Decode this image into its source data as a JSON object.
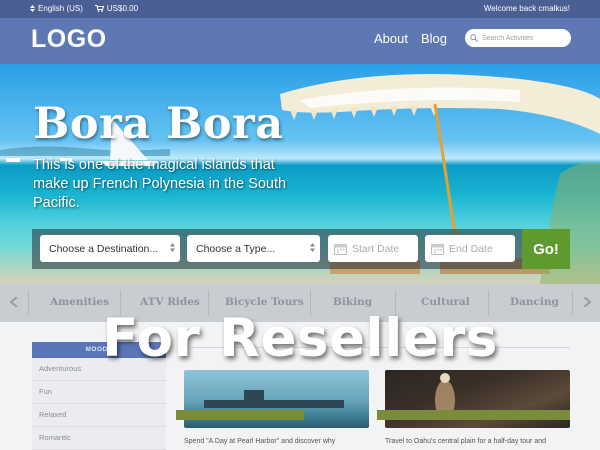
{
  "topbar": {
    "language": "English (US)",
    "currency": "US$0.00",
    "welcome": "Welcome back cmalkus!"
  },
  "header": {
    "logo": "LOGO",
    "nav": [
      "About",
      "Blog"
    ],
    "search_placeholder": "Search Activities"
  },
  "hero": {
    "title": "Bora Bora",
    "description": "This is one of the magical islands that make up French Polynesia in the South Pacific."
  },
  "booking": {
    "destination": "Choose a Destination...",
    "type": "Choose a Type...",
    "start_date": "Start Date",
    "end_date": "End Date",
    "go": "Go!"
  },
  "categories": [
    "Amenities",
    "ATV Rides",
    "Bicycle Tours",
    "Biking",
    "Cultural",
    "Dancing"
  ],
  "sidebar": {
    "heading": "MOODS",
    "items": [
      "Adventurous",
      "Fun",
      "Relaxed",
      "Romantic"
    ]
  },
  "cards": [
    {
      "snippet": "Spend \"A Day at Pearl Harbor\" and discover why"
    },
    {
      "snippet": "Travel to Oahu's central plain for a half-day tour and"
    }
  ],
  "overlay": "For Resellers",
  "colors": {
    "topbar": "#4a5f94",
    "header": "#5e78b4",
    "go_button": "#5e9a2e"
  }
}
